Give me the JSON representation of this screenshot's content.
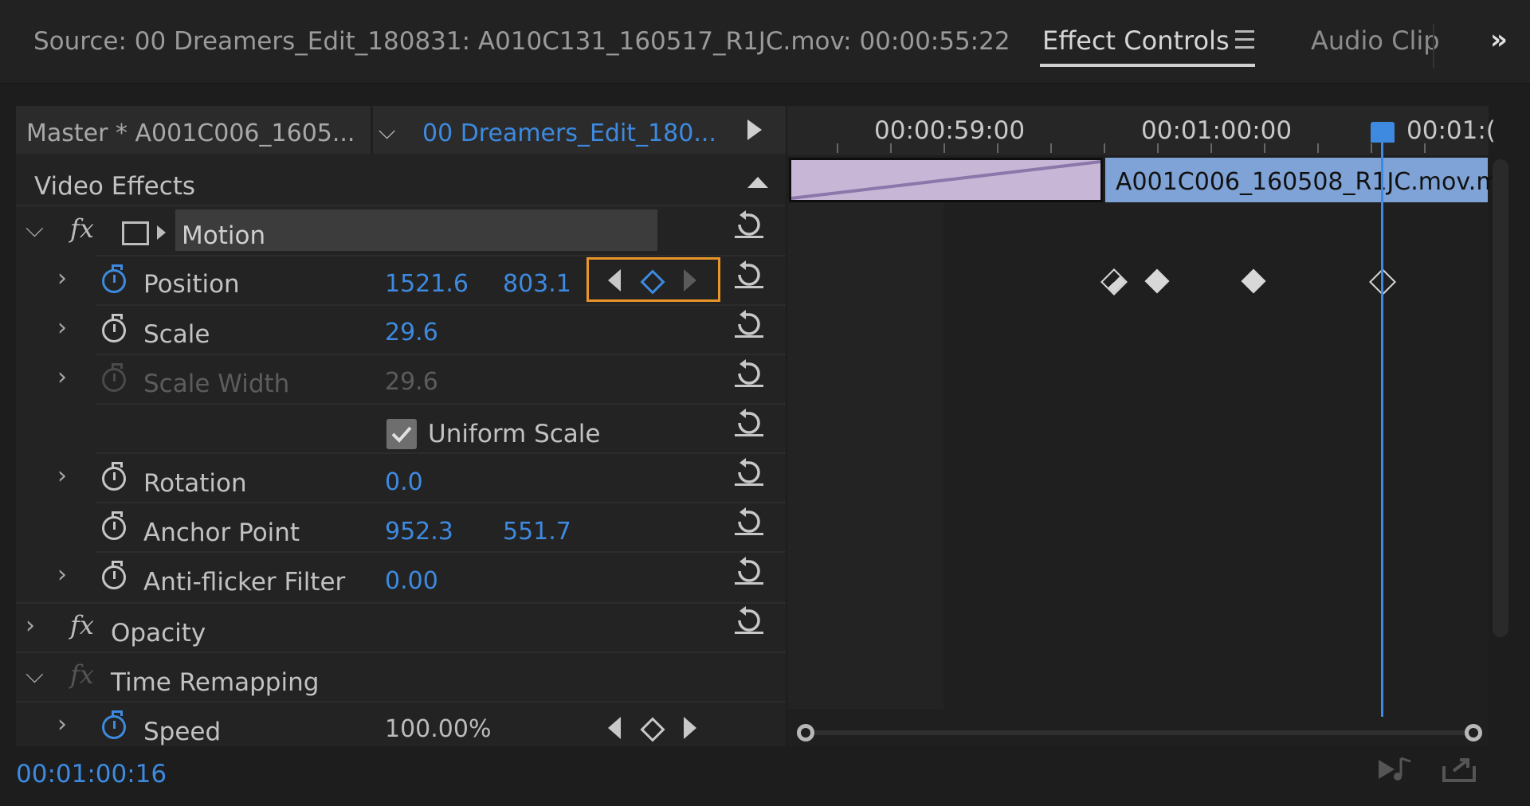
{
  "tabs": {
    "source": "Source: 00 Dreamers_Edit_180831: A010C131_160517_R1JC.mov: 00:00:55:22",
    "effect_controls": "Effect Controls",
    "audio_clip": "Audio Clip"
  },
  "clip_header": {
    "master": "Master * A001C006_1605...",
    "sequence": "00 Dreamers_Edit_180..."
  },
  "section": {
    "title": "Video Effects"
  },
  "effects": {
    "motion": "Motion",
    "position": {
      "label": "Position",
      "x": "1521.6",
      "y": "803.1"
    },
    "scale": {
      "label": "Scale",
      "value": "29.6"
    },
    "scale_width": {
      "label": "Scale Width",
      "value": "29.6"
    },
    "uniform_scale": {
      "label": "Uniform Scale",
      "checked": true
    },
    "rotation": {
      "label": "Rotation",
      "value": "0.0"
    },
    "anchor_point": {
      "label": "Anchor Point",
      "x": "952.3",
      "y": "551.7"
    },
    "anti_flicker": {
      "label": "Anti-flicker Filter",
      "value": "0.00"
    },
    "opacity": "Opacity",
    "time_remapping": "Time Remapping",
    "speed": {
      "label": "Speed",
      "value": "100.00%"
    }
  },
  "timeline": {
    "ruler": [
      "00:00:59:00",
      "00:01:00:00",
      "00:01:("
    ],
    "clip_name": "A001C006_160508_R1JC.mov.m"
  },
  "footer": {
    "timecode": "00:01:00:16"
  },
  "colors": {
    "accent": "#3d8ae0",
    "highlight": "#e8952a",
    "clip_purple": "#c7b6d6",
    "clip_blue": "#7fa3d6"
  }
}
